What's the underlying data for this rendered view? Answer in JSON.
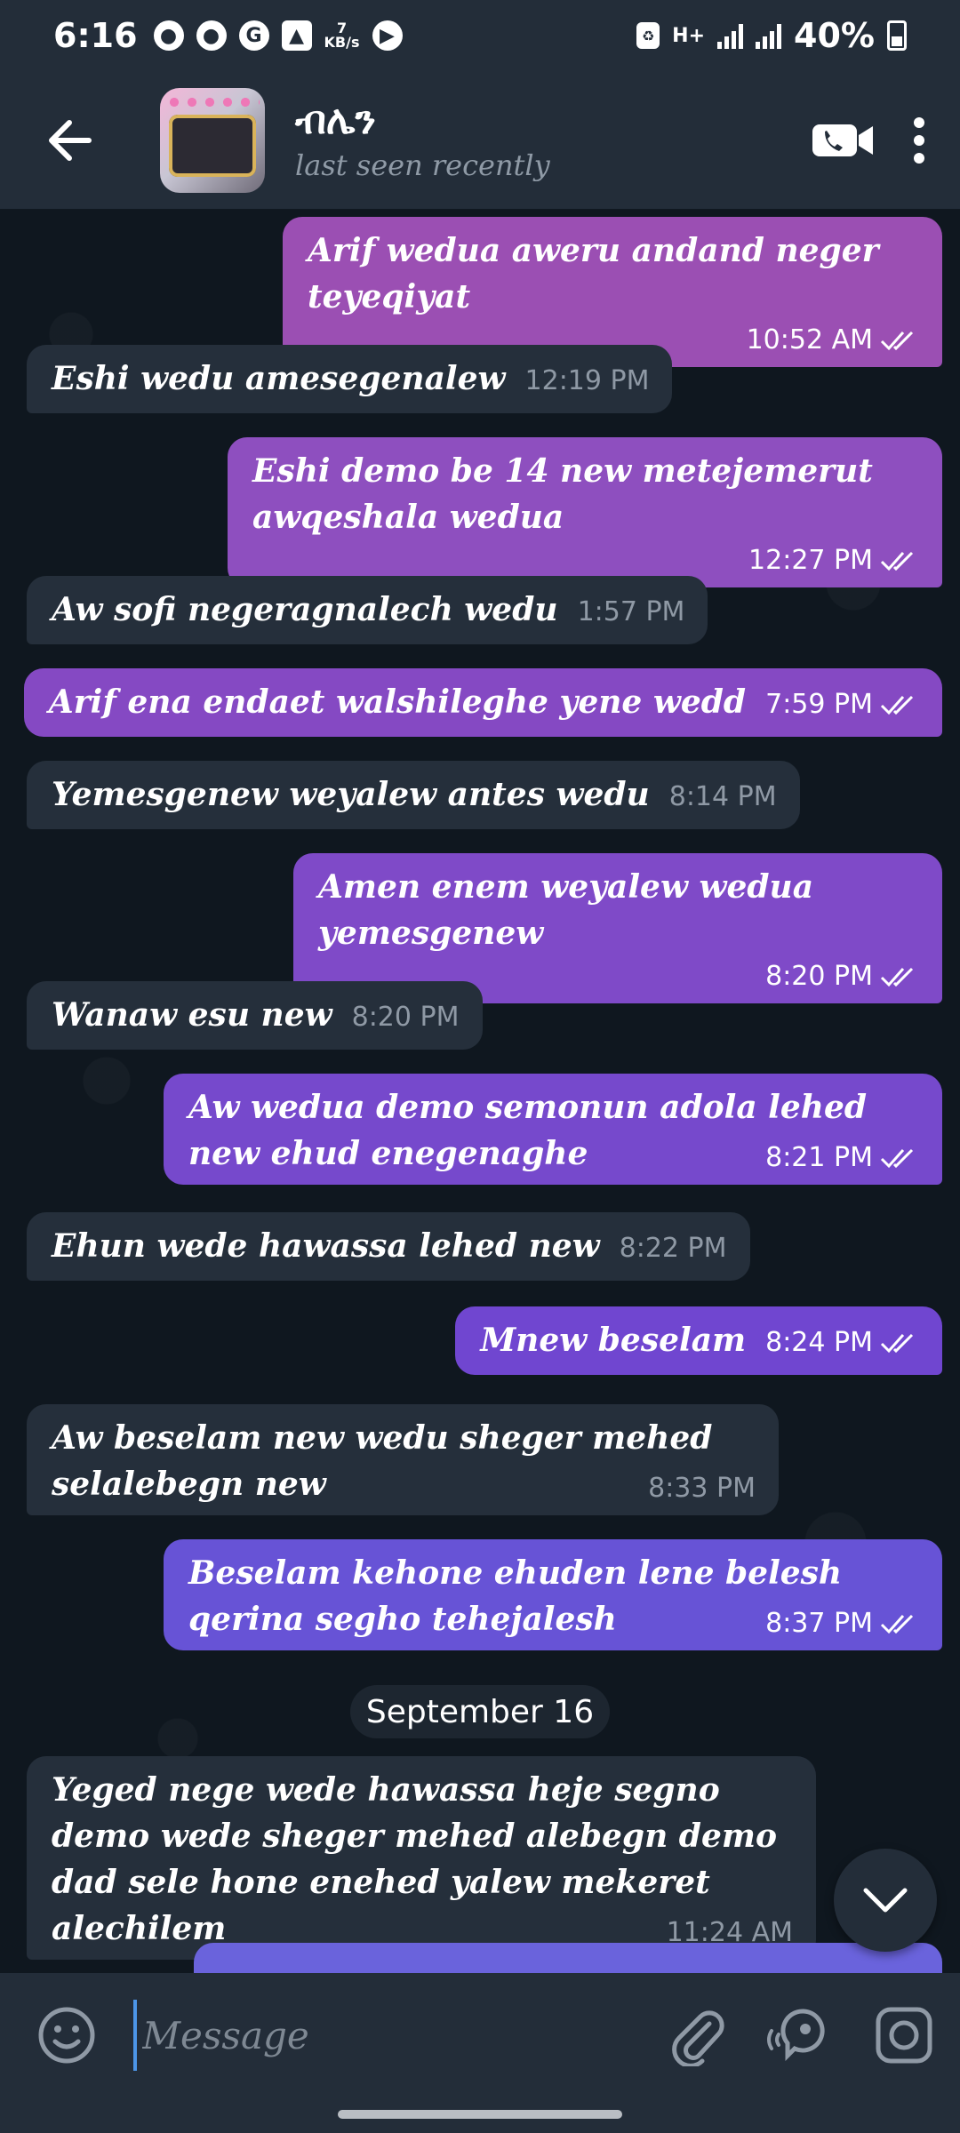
{
  "status_bar": {
    "time": "6:16",
    "net_speed_value": "7",
    "net_speed_unit": "KB/s",
    "network_type": "H+",
    "battery": "40%"
  },
  "header": {
    "contact_name": "ብሌን",
    "status": "last seen recently"
  },
  "messages": [
    {
      "dir": "out",
      "text": "Arif wedua aweru andand neger teyeqiyat",
      "time": "10:52 AM",
      "color": "#9b4fb3"
    },
    {
      "dir": "in",
      "text": "Eshi wedu amesegenalew",
      "time": "12:19 PM"
    },
    {
      "dir": "out",
      "text": "Eshi demo be 14 new metejemerut awqeshala wedua",
      "time": "12:27 PM",
      "color": "#8e4fbf"
    },
    {
      "dir": "in",
      "text": "Aw sofi negeragnalech wedu",
      "time": "1:57 PM"
    },
    {
      "dir": "out",
      "text": "Arif ena endaet walshileghe yene wedd",
      "time": "7:59 PM",
      "color": "#8549c3"
    },
    {
      "dir": "in",
      "text": "Yemesgenew weyalew antes wedu",
      "time": "8:14 PM"
    },
    {
      "dir": "out",
      "text": "Amen enem weyalew wedua yemesgenew",
      "time": "8:20 PM",
      "color": "#7f4ac8"
    },
    {
      "dir": "in",
      "text": "Wanaw esu new",
      "time": "8:20 PM"
    },
    {
      "dir": "out",
      "text": "Aw wedua demo semonun adola lehed new ehud enegenaghe",
      "time": "8:21 PM",
      "color": "#7649cc"
    },
    {
      "dir": "in",
      "text": "Ehun wede hawassa lehed new",
      "time": "8:22 PM"
    },
    {
      "dir": "out",
      "text": "Mnew beselam",
      "time": "8:24 PM",
      "color": "#7046d0"
    },
    {
      "dir": "in",
      "text": "Aw beselam new wedu sheger mehed selalebegn new",
      "time": "8:33 PM"
    },
    {
      "dir": "out",
      "text": "Beselam kehone ehuden lene belesh qerina segho tehejalesh",
      "time": "8:37 PM",
      "color": "#6753d6"
    },
    {
      "dir": "in",
      "text": "Yeged nege wede hawassa heje segno demo wede sheger mehed alebegn demo  dad sele hone enehed yalew mekeret alechilem",
      "time": "11:24 AM"
    }
  ],
  "date_separator": "September 16",
  "input": {
    "placeholder": "Message"
  },
  "colors": {
    "background": "#0f171f",
    "bar": "#232d39",
    "incoming_bubble": "#252f3b",
    "cursor": "#4c95e8"
  },
  "icons": [
    "back-arrow-icon",
    "video-call-icon",
    "more-vert-icon",
    "emoji-icon",
    "attach-icon",
    "voice-message-icon",
    "camera-icon",
    "chevron-down-icon"
  ]
}
